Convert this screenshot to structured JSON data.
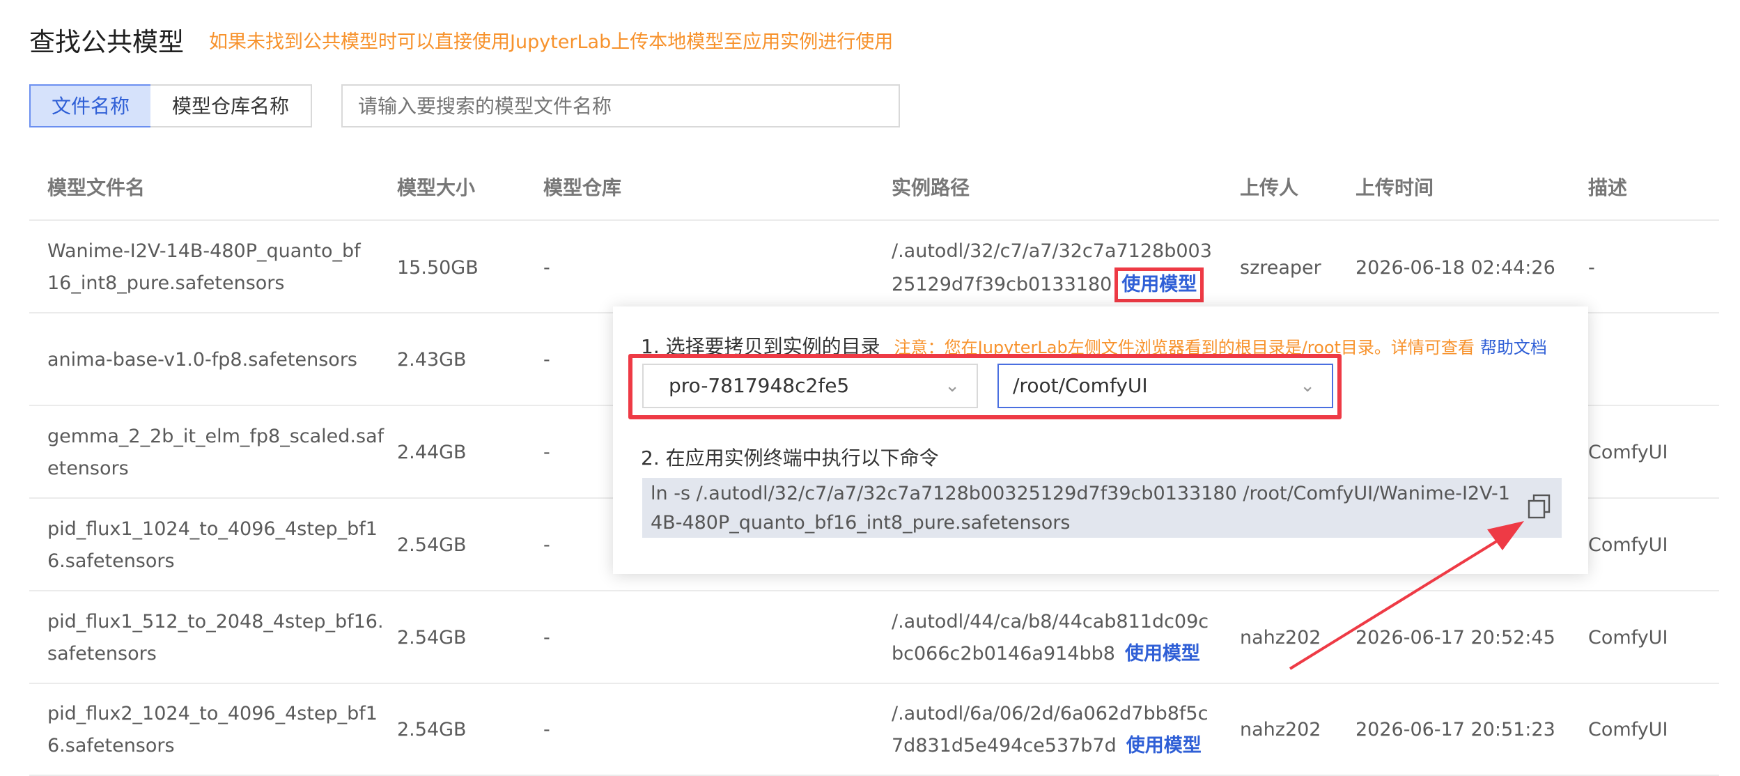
{
  "header": {
    "title": "查找公共模型",
    "notice": "如果未找到公共模型时可以直接使用JupyterLab上传本地模型至应用实例进行使用"
  },
  "search": {
    "tabs": [
      "文件名称",
      "模型仓库名称"
    ],
    "placeholder": "请输入要搜索的模型文件名称"
  },
  "table": {
    "columns": [
      "模型文件名",
      "模型大小",
      "模型仓库",
      "实例路径",
      "上传人",
      "上传时间",
      "描述"
    ],
    "rows": [
      {
        "name_l1": "Wanime-I2V-14B-480P_quanto_bf",
        "name_l2": "16_int8_pure.safetensors",
        "size": "15.50GB",
        "repo": "-",
        "path_l1": "/.autodl/32/c7/a7/32c7a7128b003",
        "path_l2": "25129d7f39cb0133180",
        "action": "使用模型",
        "uploader": "szreaper",
        "time": "2026-06-18 02:44:26",
        "desc": "-"
      },
      {
        "name_l1": "anima-base-v1.0-fp8.safetensors",
        "name_l2": "",
        "size": "2.43GB",
        "repo": "-",
        "path_l1": "",
        "path_l2": "",
        "action": "",
        "uploader": "",
        "time": "",
        "desc": ""
      },
      {
        "name_l1": "gemma_2_2b_it_elm_fp8_scaled.saf",
        "name_l2": "etensors",
        "size": "2.44GB",
        "repo": "-",
        "path_l1": "",
        "path_l2": "",
        "action": "",
        "uploader": "",
        "time": "",
        "desc": "ComfyUI"
      },
      {
        "name_l1": "pid_flux1_1024_to_4096_4step_bf1",
        "name_l2": "6.safetensors",
        "size": "2.54GB",
        "repo": "-",
        "path_l1": "",
        "path_l2": "",
        "action": "",
        "uploader": "",
        "time": "",
        "desc": "ComfyUI"
      },
      {
        "name_l1": "pid_flux1_512_to_2048_4step_bf16.",
        "name_l2": "safetensors",
        "size": "2.54GB",
        "repo": "-",
        "path_l1": "/.autodl/44/ca/b8/44cab811dc09c",
        "path_l2": "bc066c2b0146a914bb8",
        "action": "使用模型",
        "uploader": "nahz202",
        "time": "2026-06-17 20:52:45",
        "desc": "ComfyUI"
      },
      {
        "name_l1": "pid_flux2_1024_to_4096_4step_bf1",
        "name_l2": "6.safetensors",
        "size": "2.54GB",
        "repo": "-",
        "path_l1": "/.autodl/6a/06/2d/6a062d7bb8f5c",
        "path_l2": "7d831d5e494ce537b7d",
        "action": "使用模型",
        "uploader": "nahz202",
        "time": "2026-06-17 20:51:23",
        "desc": "ComfyUI"
      }
    ]
  },
  "popup": {
    "step1_label": "1. 选择要拷贝到实例的目录",
    "step1_warning": "注意：您在JupyterLab左侧文件浏览器看到的根目录是/root目录。详情可查看",
    "help_link": "帮助文档",
    "instance_select": "pro-7817948c2fe5",
    "dir_select": "/root/ComfyUI",
    "step2_label": "2. 在应用实例终端中执行以下命令",
    "command": "ln -s /.autodl/32/c7/a7/32c7a7128b00325129d7f39cb0133180 /root/ComfyUI/Wanime-I2V-14B-480P_quanto_bf16_int8_pure.safetensors"
  },
  "icons": {
    "copy": "copy-icon",
    "chevron": "chevron-down-icon"
  },
  "colors": {
    "accent": "#2f5fd6",
    "notice": "#f7922c",
    "highlight": "#ee3a45",
    "tab_active_bg": "#d6e2fb"
  }
}
